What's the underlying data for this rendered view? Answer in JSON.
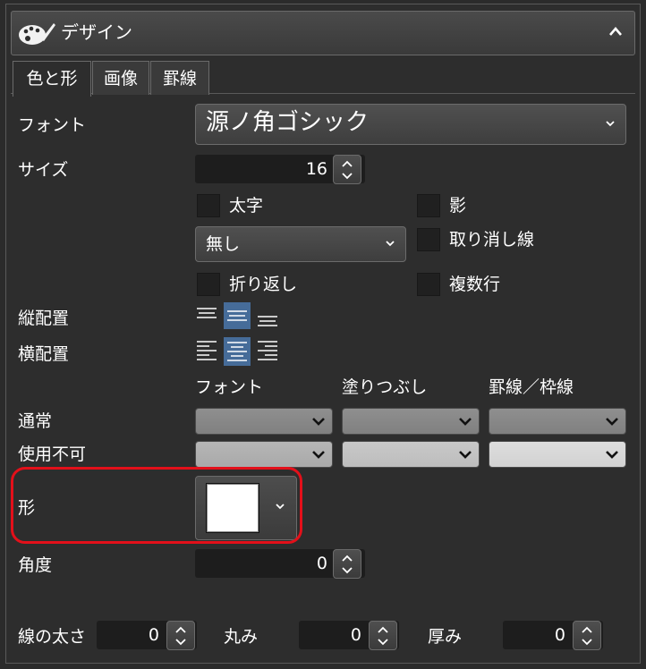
{
  "panel": {
    "title": "デザイン",
    "palette_icon": "palette-icon",
    "collapse_icon": "chevron-up-icon"
  },
  "tabs": [
    {
      "label": "色と形",
      "active": true
    },
    {
      "label": "画像",
      "active": false
    },
    {
      "label": "罫線",
      "active": false
    }
  ],
  "font": {
    "label": "フォント",
    "value": "源ノ角ゴシック"
  },
  "size": {
    "label": "サイズ",
    "value": "16"
  },
  "checkboxes": {
    "bold": "太字",
    "shadow": "影",
    "strikethrough": "取り消し線",
    "wrap": "折り返し",
    "multiline": "複数行"
  },
  "underline": {
    "value": "無し"
  },
  "vertical_align": {
    "label": "縦配置",
    "selected": "middle"
  },
  "horizontal_align": {
    "label": "横配置",
    "selected": "center"
  },
  "color_headers": {
    "font": "フォント",
    "fill": "塗りつぶし",
    "border": "罫線／枠線"
  },
  "rows": {
    "normal": "通常",
    "disabled": "使用不可"
  },
  "colors": {
    "normal": "#888888",
    "disabled_font": "#b0b0b0",
    "disabled_fill": "#c3c3c3",
    "disabled_border": "#d8d8d8",
    "highlight": "#e3101a",
    "align_active": "#466c99"
  },
  "shape": {
    "label": "形",
    "swatch_color": "#ffffff"
  },
  "angle": {
    "label": "角度",
    "value": "0"
  },
  "line_width": {
    "label": "線の太さ",
    "value": "0"
  },
  "roundness": {
    "label": "丸み",
    "value": "0"
  },
  "thickness": {
    "label": "厚み",
    "value": "0"
  }
}
